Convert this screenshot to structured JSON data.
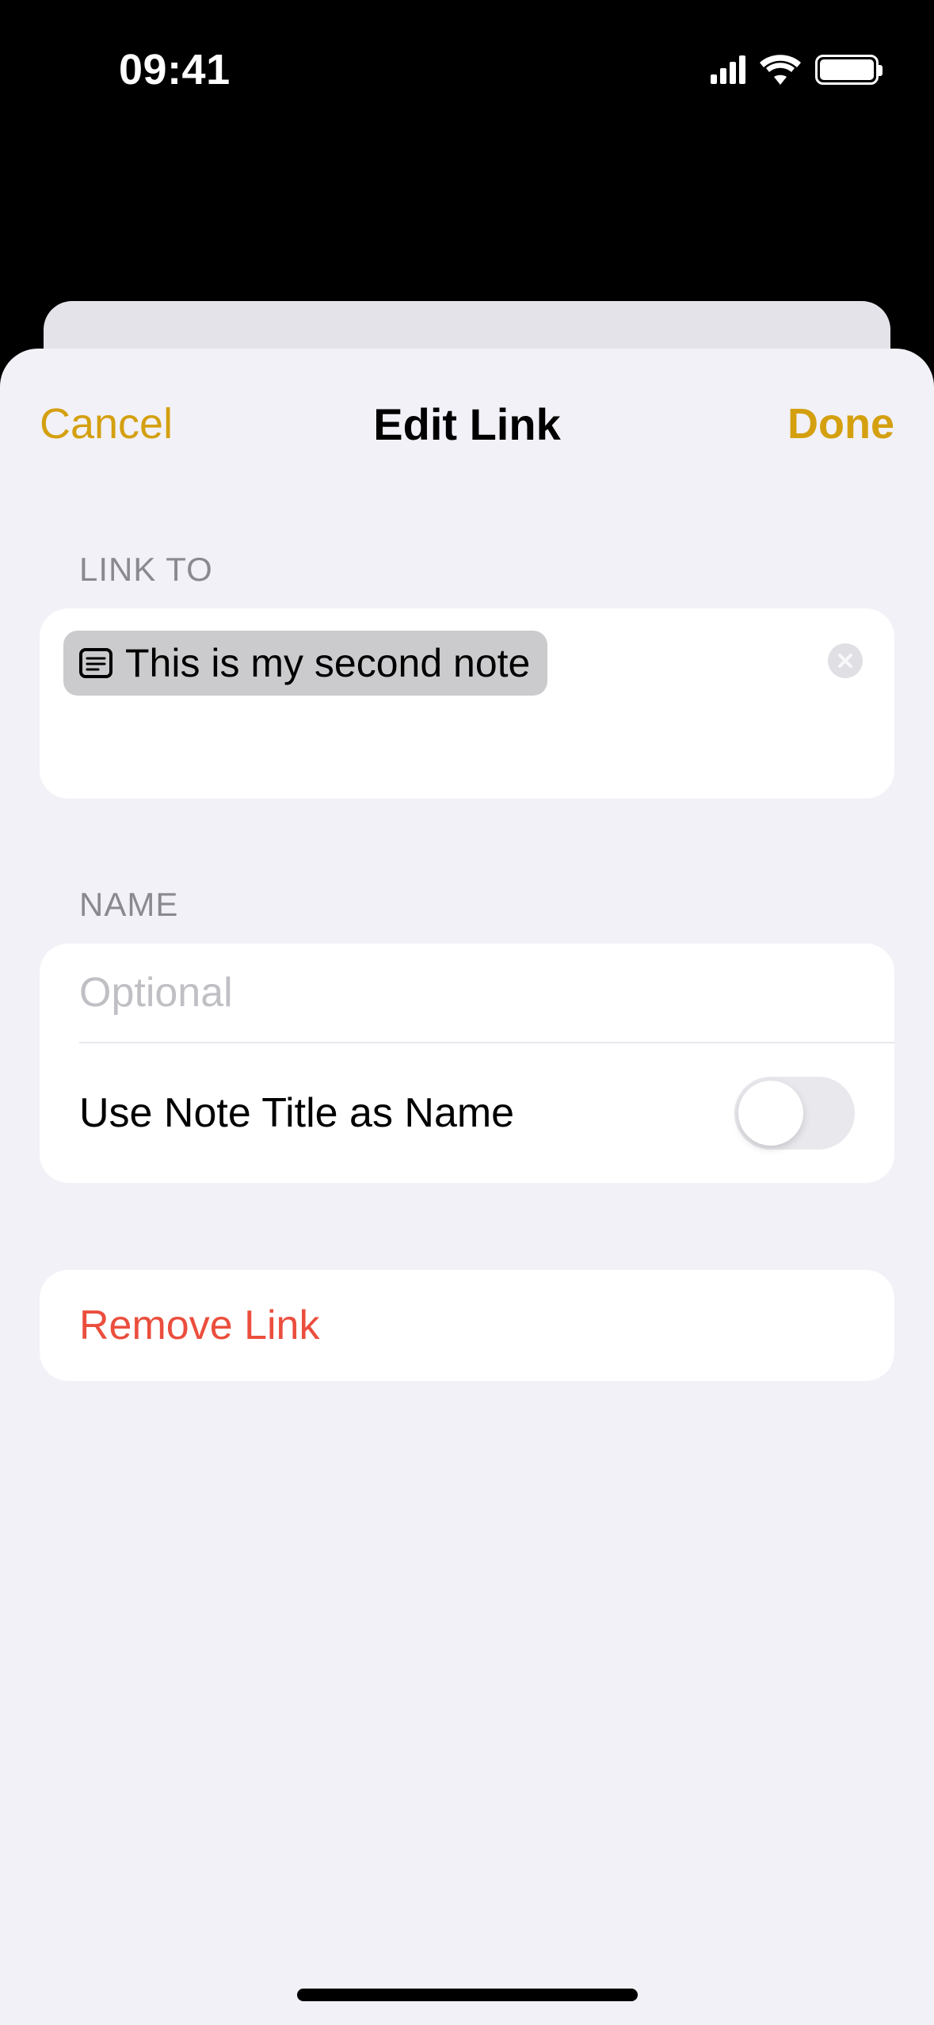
{
  "status": {
    "time": "09:41"
  },
  "nav": {
    "cancel": "Cancel",
    "title": "Edit Link",
    "done": "Done"
  },
  "linkto": {
    "header": "LINK TO",
    "token_text": "This is my second note"
  },
  "name_section": {
    "header": "NAME",
    "placeholder": "Optional",
    "value": "",
    "toggle_label": "Use Note Title as Name",
    "toggle_on": false
  },
  "remove": {
    "label": "Remove Link"
  },
  "colors": {
    "accent": "#d4a010",
    "destructive": "#eb4e3d",
    "sheet_bg": "#f2f1f7"
  }
}
